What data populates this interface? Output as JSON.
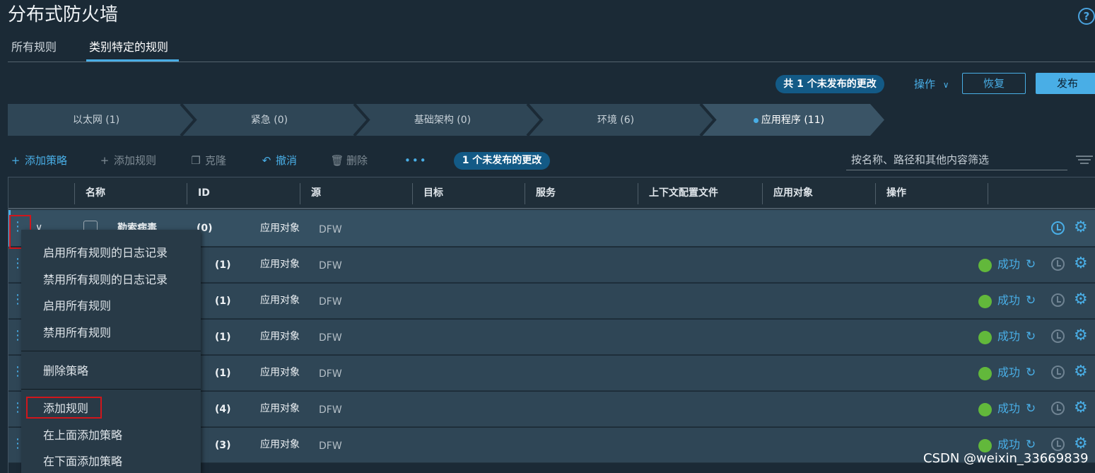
{
  "page": {
    "title": "分布式防火墙",
    "help_glyph": "?"
  },
  "tabs": [
    {
      "label": "所有规则",
      "active": false
    },
    {
      "label": "类别特定的规则",
      "active": true
    }
  ],
  "actions": {
    "unpublished_badge": "共 1 个未发布的更改",
    "operations_label": "操作",
    "revert_label": "恢复",
    "publish_label": "发布"
  },
  "categories": [
    {
      "label": "以太网 (1)",
      "active": false
    },
    {
      "label": "紧急 (0)",
      "active": false
    },
    {
      "label": "基础架构 (0)",
      "active": false
    },
    {
      "label": "环境 (6)",
      "active": false
    },
    {
      "label": "应用程序 (11)",
      "active": true
    }
  ],
  "toolbar": {
    "add_policy": "添加策略",
    "add_rule": "添加规则",
    "clone": "克隆",
    "undo": "撤消",
    "delete": "删除",
    "more": "•••",
    "pending_badge": "1 个未发布的更改",
    "filter_placeholder": "按名称、路径和其他内容筛选"
  },
  "table": {
    "columns": [
      "名称",
      "ID",
      "源",
      "目标",
      "服务",
      "上下文配置文件",
      "应用对象",
      "操作"
    ],
    "policy_row": {
      "name": "勒索病毒",
      "id": "(0)",
      "applied_to": "应用对象",
      "target": "DFW"
    },
    "rows": [
      {
        "id": "(1)",
        "applied_to": "应用对象",
        "target": "DFW",
        "status": "成功"
      },
      {
        "id": "(1)",
        "applied_to": "应用对象",
        "target": "DFW",
        "status": "成功"
      },
      {
        "id": "(1)",
        "applied_to": "应用对象",
        "target": "DFW",
        "status": "成功"
      },
      {
        "id": "(1)",
        "applied_to": "应用对象",
        "target": "DFW",
        "status": "成功"
      },
      {
        "id": "(4)",
        "applied_to": "应用对象",
        "target": "DFW",
        "status": "成功"
      },
      {
        "id": "(3)",
        "applied_to": "应用对象",
        "target": "DFW",
        "status": "成功"
      }
    ]
  },
  "context_menu": {
    "items": [
      "启用所有规则的日志记录",
      "禁用所有规则的日志记录",
      "启用所有规则",
      "禁用所有规则",
      "删除策略",
      "添加规则",
      "在上面添加策略",
      "在下面添加策略"
    ],
    "highlighted": "添加规则"
  },
  "watermark": "CSDN @weixin_33669839",
  "colors": {
    "background": "#1b2a36",
    "accent": "#49aee6",
    "row": "#2f4656",
    "success": "#62b83b",
    "highlight_border": "#d0161c"
  },
  "icons": {
    "add": "plus-icon",
    "clone": "clone-icon",
    "undo": "undo-icon",
    "delete": "trash-icon",
    "more": "ellipsis-icon",
    "filter": "filter-lines-icon",
    "row_menu": "kebab-icon",
    "expand": "chevron-down-icon",
    "stats": "clock-icon",
    "settings": "gear-icon",
    "refresh": "refresh-icon",
    "status": "status-dot-icon"
  }
}
